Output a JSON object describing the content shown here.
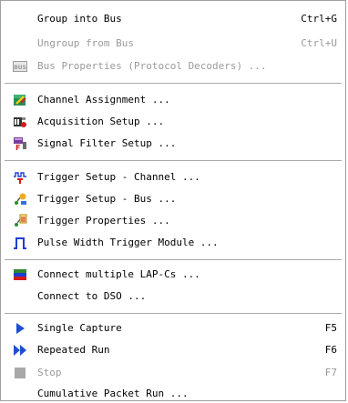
{
  "menu": {
    "items": [
      {
        "label": "Group into Bus",
        "shortcut": "Ctrl+G",
        "icon": "none"
      },
      {
        "label": "Ungroup from Bus",
        "shortcut": "Ctrl+U",
        "icon": "none"
      },
      {
        "label": "Bus Properties (Protocol Decoders) ...",
        "shortcut": "",
        "icon": "bus-icon",
        "icon_text": "BUS"
      },
      {
        "label": "Channel Assignment ...",
        "shortcut": "",
        "icon": "channel-assignment-icon"
      },
      {
        "label": "Acquisition Setup ...",
        "shortcut": "",
        "icon": "acquisition-setup-icon"
      },
      {
        "label": "Signal Filter Setup ...",
        "shortcut": "",
        "icon": "signal-filter-icon"
      },
      {
        "label": "Trigger Setup - Channel ...",
        "shortcut": "",
        "icon": "trigger-channel-icon"
      },
      {
        "label": "Trigger Setup - Bus ...",
        "shortcut": "",
        "icon": "trigger-bus-icon"
      },
      {
        "label": "Trigger Properties ...",
        "shortcut": "",
        "icon": "trigger-properties-icon"
      },
      {
        "label": "Pulse Width Trigger Module ...",
        "shortcut": "",
        "icon": "pulse-width-icon"
      },
      {
        "label": "Connect multiple LAP-Cs ...",
        "shortcut": "",
        "icon": "connect-lap-icon"
      },
      {
        "label": "Connect to DSO ...",
        "shortcut": "",
        "icon": "none"
      },
      {
        "label": "Single Capture",
        "shortcut": "F5",
        "icon": "play-icon"
      },
      {
        "label": "Repeated Run",
        "shortcut": "F6",
        "icon": "fast-forward-icon"
      },
      {
        "label": "Stop",
        "shortcut": "F7",
        "icon": "stop-icon"
      },
      {
        "label": "Cumulative Packet Run ...",
        "shortcut": "",
        "icon": "none"
      }
    ]
  },
  "colors": {
    "disabled_text": "#9a9a9a",
    "play_blue": "#1f4fd1",
    "stop_gray": "#a8a8a8"
  }
}
